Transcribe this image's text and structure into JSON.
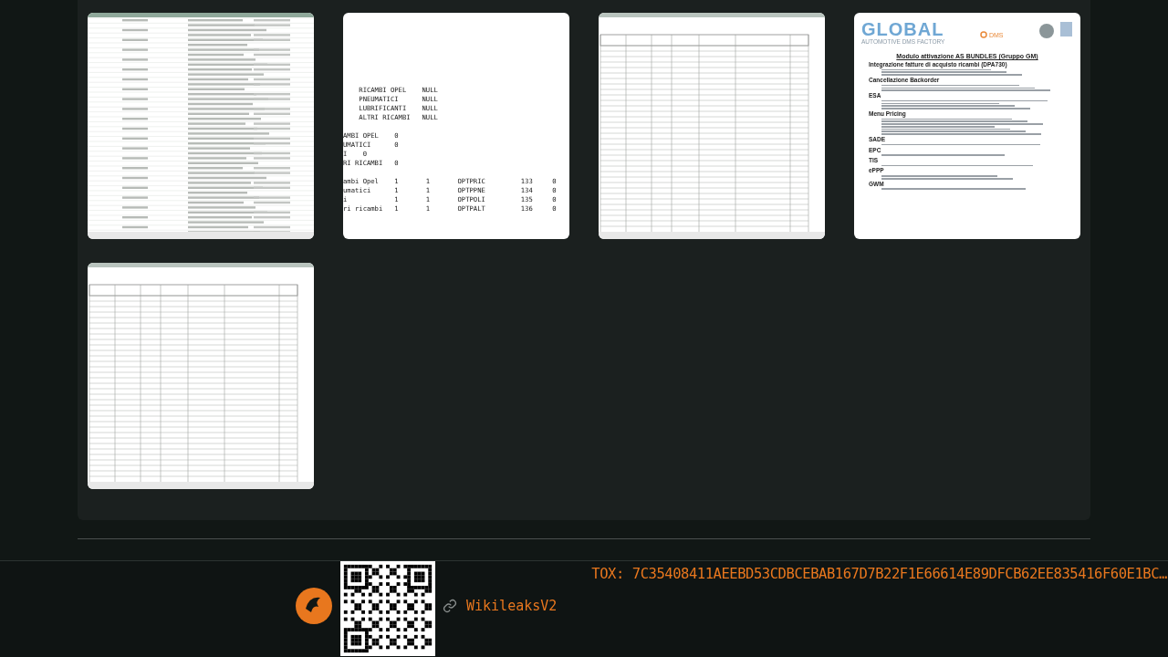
{
  "thumbnails": [
    {
      "kind": "spreadsheet"
    },
    {
      "kind": "text",
      "blocks": [
        [
          "    RICAMBI OPEL    NULL",
          "    PNEUMATICI      NULL",
          "    LUBRIFICANTI    NULL",
          "    ALTRI RICAMBI   NULL"
        ],
        [
          "AMBI OPEL    0",
          "UMATICI      0",
          "I    0",
          "RI RICAMBI   0"
        ],
        [
          "ambi Opel    1       1       OPTPRIC         133     0",
          "umatici      1       1       OPTPPNE         134     0",
          "i            1       1       OPTPOLI         135     0",
          "ri ricambi   1       1       OPTPALT         136     0"
        ]
      ]
    },
    {
      "kind": "form"
    },
    {
      "kind": "document",
      "logo": "GLOBAL",
      "tagline": "AUTOMOTIVE DMS FACTORY",
      "brand": "DMS",
      "title": "Modulo attivazione AS BUNDLES (Gruppo GM)",
      "sections": [
        {
          "heading": "Integrazione fatture di acquisto ricambi (DPA730)"
        },
        {
          "heading": "Cancellazione Backorder"
        },
        {
          "heading": "ESA"
        },
        {
          "heading": "Menu Pricing"
        },
        {
          "heading": "SADE"
        },
        {
          "heading": "EPC"
        },
        {
          "heading": "TIS"
        },
        {
          "heading": "ePPP"
        },
        {
          "heading": "GWM"
        }
      ]
    },
    {
      "kind": "form"
    }
  ],
  "footer": {
    "link": "WikileaksV2",
    "tox": "TOX: 7C35408411AEEBD53CDBCEBAB167D7B22F1E66614E89DFCB62EE835416F60E1BC…"
  }
}
